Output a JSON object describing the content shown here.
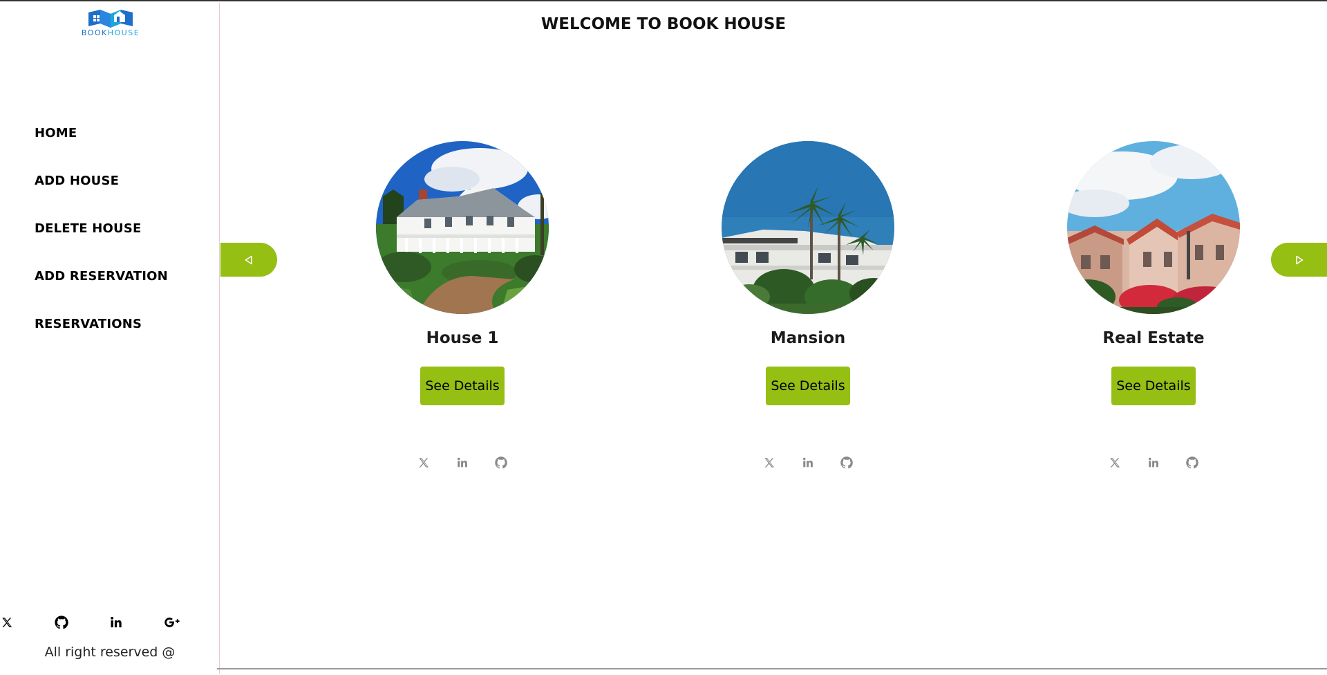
{
  "app": {
    "logo_text_primary": "BOOK",
    "logo_text_accent": "HOUSE"
  },
  "sidebar": {
    "nav": [
      {
        "label": "HOME"
      },
      {
        "label": "ADD HOUSE"
      },
      {
        "label": "DELETE HOUSE"
      },
      {
        "label": "ADD RESERVATION"
      },
      {
        "label": "RESERVATIONS"
      }
    ],
    "social_icons": [
      "x-icon",
      "github-icon",
      "linkedin-icon",
      "google-plus-icon"
    ],
    "copyright": "All right reserved @"
  },
  "main": {
    "title": "WELCOME TO BOOK HOUSE",
    "prev_icon": "triangle-left-icon",
    "next_icon": "triangle-right-icon",
    "cards": [
      {
        "name": "House 1",
        "button_label": "See Details",
        "image": "white-victorian-mansion-photo",
        "social_icons": [
          "x-icon",
          "linkedin-icon",
          "github-icon"
        ]
      },
      {
        "name": "Mansion",
        "button_label": "See Details",
        "image": "palm-tree-building-photo",
        "social_icons": [
          "x-icon",
          "linkedin-icon",
          "github-icon"
        ]
      },
      {
        "name": "Real Estate",
        "button_label": "See Details",
        "image": "red-roof-townhouses-photo",
        "social_icons": [
          "x-icon",
          "linkedin-icon",
          "github-icon"
        ]
      }
    ]
  },
  "colors": {
    "accent": "#95bf13",
    "logo_blue": "#1e6fc9",
    "logo_light_blue": "#1fa6de",
    "icon_gray": "#8a8a8a"
  }
}
